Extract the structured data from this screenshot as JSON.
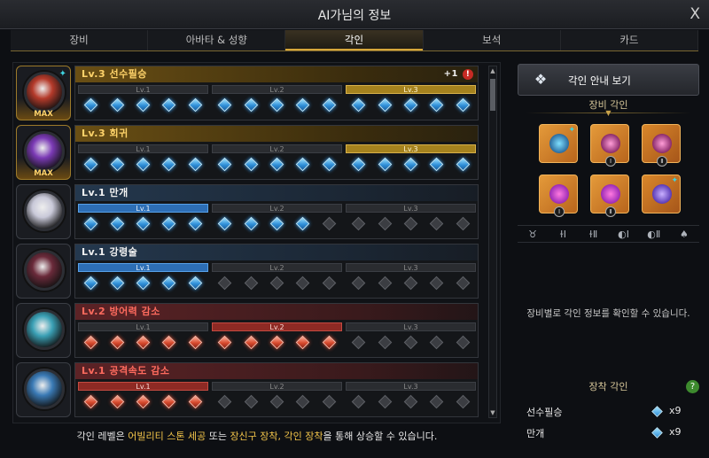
{
  "window": {
    "title": "AI가님의 정보",
    "close_label": "X"
  },
  "tabs": [
    "장비",
    "아바타 & 성향",
    "각인",
    "보석",
    "카드"
  ],
  "active_tab": 2,
  "engravings": [
    {
      "name": "Lv.3 선수필승",
      "tone": "gold",
      "max": true,
      "max_label": "MAX",
      "bonus": "+1",
      "warn": "!",
      "levels": [
        {
          "label": "Lv.1",
          "tone": ""
        },
        {
          "label": "Lv.2",
          "tone": ""
        },
        {
          "label": "Lv.3",
          "tone": "gold"
        }
      ],
      "nodes": [
        [
          "blue",
          "blue",
          "blue",
          "blue",
          "blue"
        ],
        [
          "blue",
          "blue",
          "blue",
          "blue",
          "blue"
        ],
        [
          "blue",
          "blue",
          "blue",
          "blue",
          "blue"
        ]
      ]
    },
    {
      "name": "Lv.3 회귀",
      "tone": "gold",
      "max": true,
      "max_label": "MAX",
      "bonus": "",
      "warn": "",
      "levels": [
        {
          "label": "Lv.1",
          "tone": ""
        },
        {
          "label": "Lv.2",
          "tone": ""
        },
        {
          "label": "Lv.3",
          "tone": "gold"
        }
      ],
      "nodes": [
        [
          "blue",
          "blue",
          "blue",
          "blue",
          "blue"
        ],
        [
          "blue",
          "blue",
          "blue",
          "blue",
          "blue"
        ],
        [
          "blue",
          "blue",
          "blue",
          "blue",
          "blue"
        ]
      ]
    },
    {
      "name": "Lv.1 만개",
      "tone": "blue",
      "max": false,
      "max_label": "",
      "bonus": "",
      "warn": "",
      "levels": [
        {
          "label": "Lv.1",
          "tone": "blue"
        },
        {
          "label": "Lv.2",
          "tone": ""
        },
        {
          "label": "Lv.3",
          "tone": ""
        }
      ],
      "nodes": [
        [
          "blue",
          "blue",
          "blue",
          "blue",
          "blue"
        ],
        [
          "blue",
          "blue",
          "blue",
          "blue",
          "empty"
        ],
        [
          "empty",
          "empty",
          "empty",
          "empty",
          "empty"
        ]
      ]
    },
    {
      "name": "Lv.1 강령술",
      "tone": "blue",
      "max": false,
      "max_label": "",
      "bonus": "",
      "warn": "",
      "levels": [
        {
          "label": "Lv.1",
          "tone": "blue"
        },
        {
          "label": "Lv.2",
          "tone": ""
        },
        {
          "label": "Lv.3",
          "tone": ""
        }
      ],
      "nodes": [
        [
          "blue",
          "blue",
          "blue",
          "blue",
          "blue"
        ],
        [
          "empty",
          "empty",
          "empty",
          "empty",
          "empty"
        ],
        [
          "empty",
          "empty",
          "empty",
          "empty",
          "empty"
        ]
      ]
    },
    {
      "name": "Lv.2 방어력 감소",
      "tone": "red",
      "max": false,
      "max_label": "",
      "bonus": "",
      "warn": "",
      "levels": [
        {
          "label": "Lv.1",
          "tone": ""
        },
        {
          "label": "Lv.2",
          "tone": "red"
        },
        {
          "label": "Lv.3",
          "tone": ""
        }
      ],
      "nodes": [
        [
          "red",
          "red",
          "red",
          "red",
          "red"
        ],
        [
          "red",
          "red",
          "red",
          "red",
          "red"
        ],
        [
          "empty",
          "empty",
          "empty",
          "empty",
          "empty"
        ]
      ]
    },
    {
      "name": "Lv.1 공격속도 감소",
      "tone": "red",
      "max": false,
      "max_label": "",
      "bonus": "",
      "warn": "",
      "levels": [
        {
          "label": "Lv.1",
          "tone": "red"
        },
        {
          "label": "Lv.2",
          "tone": ""
        },
        {
          "label": "Lv.3",
          "tone": ""
        }
      ],
      "nodes": [
        [
          "red",
          "red",
          "red",
          "red",
          "red"
        ],
        [
          "empty",
          "empty",
          "empty",
          "empty",
          "empty"
        ],
        [
          "empty",
          "empty",
          "empty",
          "empty",
          "empty"
        ]
      ]
    }
  ],
  "footer": {
    "p1": "각인 레벨은 ",
    "h1": "어빌리티 스톤 세공",
    "p2": " 또는 ",
    "h2": "장신구 장착, 각인 장착",
    "p3": "을 통해 상승할 수 있습니다."
  },
  "right": {
    "guide_button": "각인 안내 보기",
    "equip_engrave_title": "장비 각인",
    "slots": [
      {
        "kind": "necklace",
        "roman": "",
        "tgem": true
      },
      {
        "kind": "earring",
        "roman": "Ⅰ",
        "tgem": false
      },
      {
        "kind": "earring",
        "roman": "Ⅱ",
        "tgem": false
      },
      {
        "kind": "ring",
        "roman": "Ⅰ",
        "tgem": false
      },
      {
        "kind": "ring",
        "roman": "Ⅱ",
        "tgem": false
      },
      {
        "kind": "stone",
        "roman": "",
        "tgem": true
      }
    ],
    "slot_icons": [
      "necklace-icon",
      "earring-1-icon",
      "earring-2-icon",
      "ring-1-icon",
      "ring-2-icon",
      "stone-icon"
    ],
    "hint": "장비별로 각인 정보를 확인할 수 있습니다.",
    "equipped_title": "장착 각인",
    "help_label": "?",
    "equipped": [
      {
        "name": "선수필승",
        "count": "x9"
      },
      {
        "name": "만개",
        "count": "x9"
      }
    ]
  }
}
